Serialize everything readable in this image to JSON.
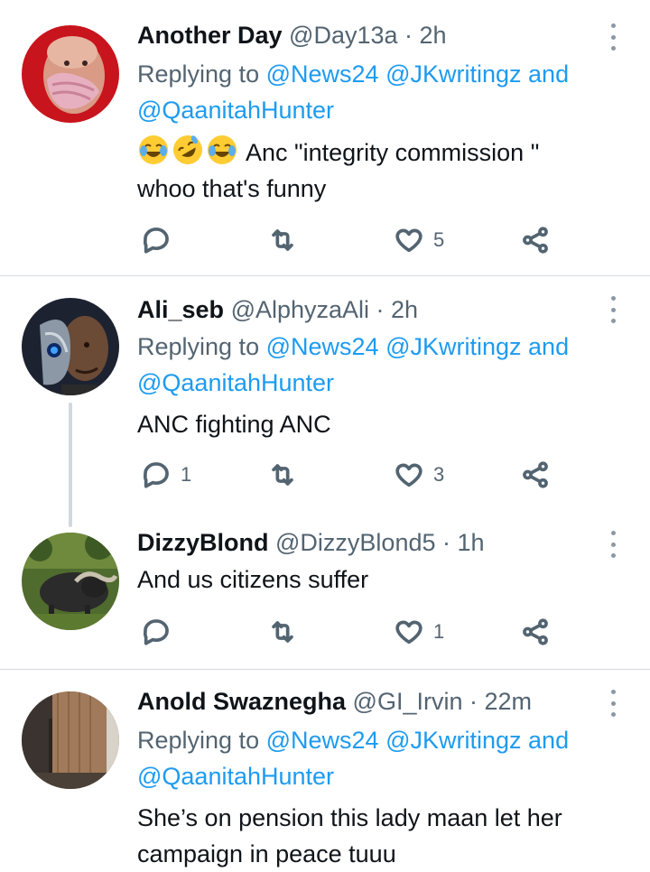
{
  "tweets": [
    {
      "name": "Another  Day",
      "handle": "@Day13a · 2h",
      "replying_prefix": "Replying to ",
      "mention1": "@News24",
      "mention2": "@JKwritingz",
      "and": " and",
      "mention3": "@QaanitahHunter",
      "emojis": [
        "😂",
        "🤣",
        "😂"
      ],
      "text": " Anc \"integrity commission \"",
      "text2": "whoo that's funny",
      "reply_count": "",
      "like_count": "5"
    },
    {
      "name": "Ali_seb",
      "handle": "@AlphyzaAli · 2h",
      "replying_prefix": "Replying to ",
      "mention1": "@News24",
      "mention2": "@JKwritingz",
      "and": " and",
      "mention3": "@QaanitahHunter",
      "text": "ANC fighting ANC",
      "reply_count": "1",
      "like_count": "3"
    },
    {
      "name": "DizzyBlond",
      "handle": "@DizzyBlond5 · 1h",
      "text": "And us citizens suffer",
      "reply_count": "",
      "like_count": "1"
    },
    {
      "name": "Anold Swaznegha",
      "handle": "@GI_Irvin · 22m",
      "replying_prefix": "Replying to ",
      "mention1": "@News24",
      "mention2": "@JKwritingz",
      "and": " and",
      "mention3": "@QaanitahHunter",
      "text": "She’s on pension this lady maan let her",
      "text2": "campaign in peace tuuu"
    }
  ],
  "colors": {
    "mention": "#1d9bf0",
    "secondary_text": "#536471",
    "primary_text": "#0f1419",
    "divider": "#d7dbdf",
    "thread_line": "#cfd9de"
  },
  "icons": {
    "reply": "reply-icon",
    "retweet": "retweet-icon",
    "like": "heart-icon",
    "share": "share-icon",
    "more": "more-options-icon"
  }
}
